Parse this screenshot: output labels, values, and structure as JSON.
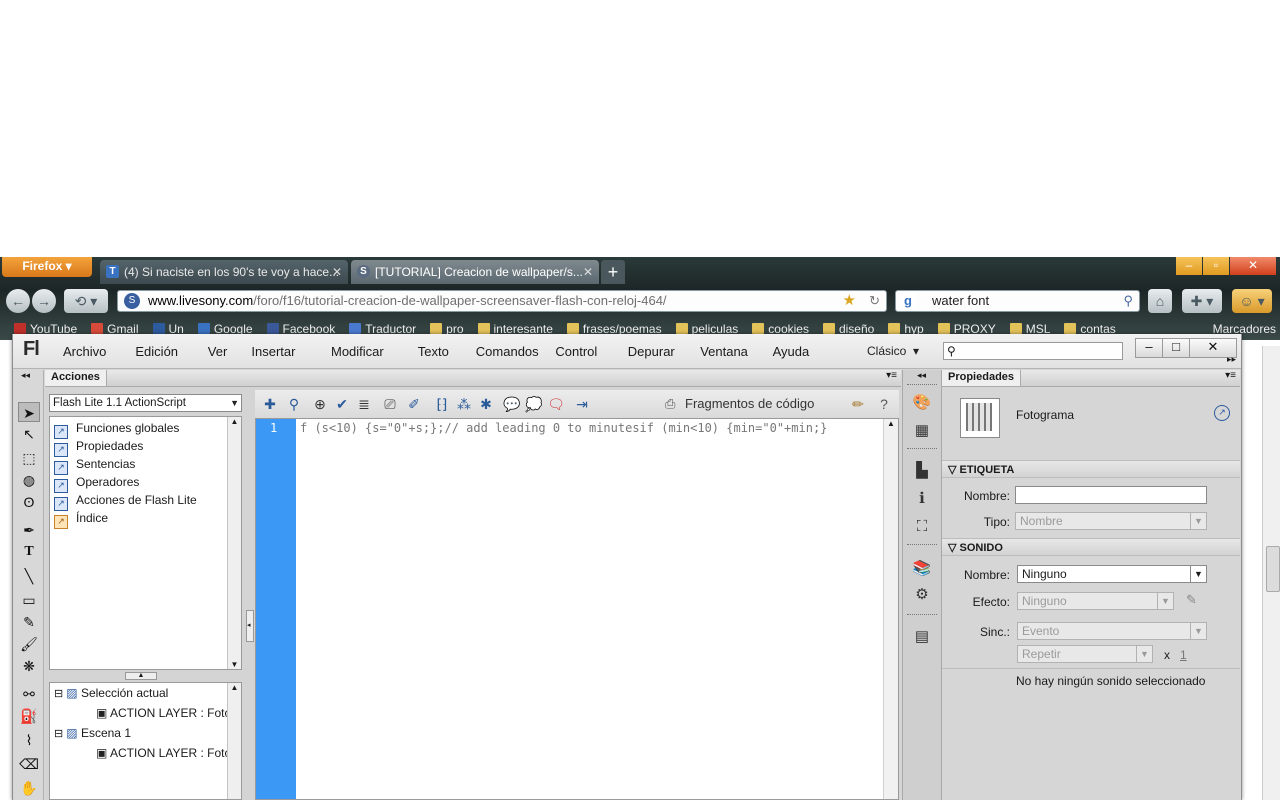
{
  "browser": {
    "firefox_button": "Firefox",
    "tabs": [
      {
        "title": "(4) Si naciste en los 90's te voy a hace...",
        "icon_text": "T"
      },
      {
        "title": "[TUTORIAL] Creacion de wallpaper/s...",
        "icon_text": "S"
      }
    ],
    "new_tab": "+",
    "url_domain": "www.livesony.com",
    "url_path": "/foro/f16/tutorial-creacion-de-wallpaper-screensaver-flash-con-reloj-464/",
    "search_value": "water font",
    "bookmarks": [
      "YouTube",
      "Gmail",
      "Un",
      "Google",
      "Facebook",
      "Traductor",
      "pro",
      "interesante",
      "frases/poemas",
      "peliculas",
      "cookies",
      "diseño",
      "hyp",
      "PROXY",
      "MSL",
      "contas"
    ],
    "bookmarks_right": "Marcadores"
  },
  "app": {
    "logo": "Fl",
    "menu": [
      "Archivo",
      "Edición",
      "Ver",
      "Insertar",
      "Modificar",
      "Texto",
      "Comandos",
      "Control",
      "Depurar",
      "Ventana",
      "Ayuda"
    ],
    "workspace": "Clásico",
    "window_controls": [
      "–",
      "□",
      "✕"
    ]
  },
  "actions_panel": {
    "tab": "Acciones",
    "version_select": "Flash Lite 1.1 ActionScript",
    "tree": [
      "Funciones globales",
      "Propiedades",
      "Sentencias",
      "Operadores",
      "Acciones de Flash Lite",
      "Índice"
    ],
    "tree2": [
      {
        "label": "Selección actual",
        "level": 0
      },
      {
        "label": "ACTION LAYER : Fotog",
        "level": 1
      },
      {
        "label": "Escena 1",
        "level": 0
      },
      {
        "label": "ACTION LAYER : Fotog",
        "level": 1
      }
    ],
    "code_snippets": "Fragmentos de código",
    "line_number": "1",
    "code": "f (s<10) {s=\"0\"+s;};// add leading 0 to minutesif (min<10) {min=\"0\"+min;}"
  },
  "properties_panel": {
    "tab": "Propiedades",
    "object_type": "Fotograma",
    "etiqueta_header": "ETIQUETA",
    "nombre_label": "Nombre:",
    "nombre_value": "",
    "tipo_label": "Tipo:",
    "tipo_value": "Nombre",
    "sonido_header": "SONIDO",
    "sonido_nombre_label": "Nombre:",
    "sonido_nombre_value": "Ninguno",
    "efecto_label": "Efecto:",
    "efecto_value": "Ninguno",
    "sinc_label": "Sinc.:",
    "sinc_value": "Evento",
    "repetir_value": "Repetir",
    "repeat_x": "x",
    "repeat_count": "1",
    "status": "No hay ningún sonido seleccionado"
  }
}
